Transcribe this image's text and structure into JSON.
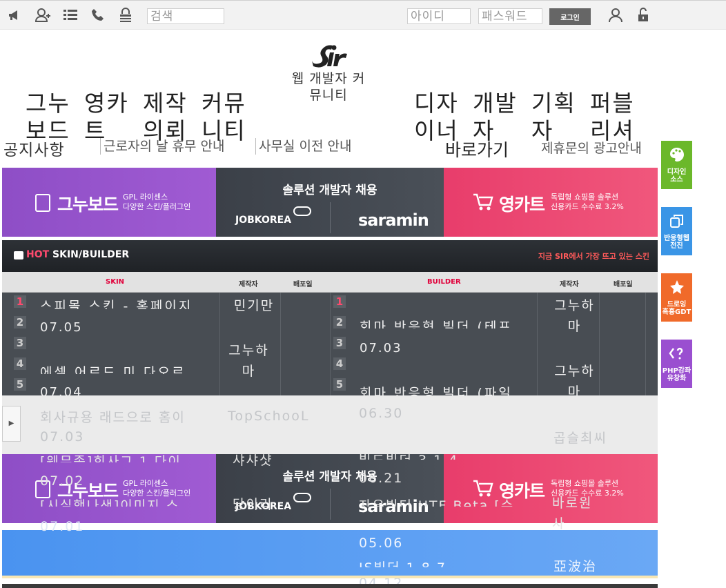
{
  "topbar": {
    "search_placeholder": "검색",
    "id_placeholder": "아이디",
    "pw_placeholder": "패스워드",
    "login_label": "로그인"
  },
  "logo": {
    "tagline": "웹 개발자 커뮤니티"
  },
  "nav_left": [
    "그누보드",
    "영카트",
    "제작의뢰",
    "커뮤니티"
  ],
  "nav_right": [
    "디자이너",
    "개발자",
    "기획자",
    "퍼블리셔"
  ],
  "notices": {
    "title": "공지사항",
    "items": [
      "근로자의 날 휴무 안내",
      "사무실 이전 안내"
    ],
    "shortcut": "바로가기",
    "ad_contact": "제휴문의 광고안내"
  },
  "banner": {
    "left_title": "그누보드",
    "left_sub1": "GPL 라이센스",
    "left_sub2": "다양한 스킨/플러그인",
    "mid_title": "솔루션 개발자 채용",
    "mid_jobkorea": "JOBKOREA",
    "mid_saramin": "saramin",
    "right_title": "영카트",
    "right_sub1": "독립형 쇼핑몰 솔루션",
    "right_sub2": "신용카드 수수료 3.2%"
  },
  "hot": {
    "title_hot": "HOT",
    "title_rest": " SKIN/BUILDER",
    "subtitle": "지금 SIR에서 가장 뜨고 있는 스킨",
    "col_skin": "SKIN",
    "col_author": "제작자",
    "col_date": "배포일",
    "col_builder": "BUILDER",
    "ranks": [
      "1",
      "2",
      "3",
      "4",
      "5"
    ],
    "skin_rows": [
      {
        "title": "스피몰 스킨 - 홈페이지",
        "date": "07.05",
        "author": "민기만"
      },
      {
        "title": "에셀 어르드 미 다오르",
        "date": "07.04",
        "author": "그누하마"
      },
      {
        "title": "회사규용 래드으로 홈이",
        "date": "07.03",
        "author": "TopSchooL"
      },
      {
        "title": "[웨뮤좃]회사그 1 다이",
        "date": "07.02",
        "author": "샤샤샷"
      },
      {
        "title": "[시실했나샌]이미지 스",
        "date": "07.01",
        "author": "당이리"
      }
    ],
    "builder_rows": [
      {
        "title": "회마 반응형 빌더 (테프",
        "date": "07.03",
        "author": "그누하마"
      },
      {
        "title": "회마 반응형 빌더 (파일",
        "date": "06.30",
        "author": "그누하마"
      },
      {
        "title": "빌드빌더 3.1.4",
        "date": "06.21",
        "author": "곱슬최씨"
      },
      {
        "title": "자유빌더 UTF Beta [수",
        "date": "05.06",
        "author": "바로원사"
      },
      {
        "title": "IS빌더 1.8.7",
        "date": "04.12",
        "author": "亞波治"
      }
    ]
  },
  "side_buttons": [
    {
      "label1": "디자인",
      "label2": "소스",
      "color": "#6bb82a"
    },
    {
      "label1": "반응형웹",
      "label2": "전진",
      "color": "#3a95e6"
    },
    {
      "label1": "드로잉",
      "label2": "흑흉GDT",
      "color": "#f06a2a"
    },
    {
      "label1": "PHP강좌",
      "label2": "유창화",
      "color": "#9a4fd0"
    }
  ]
}
